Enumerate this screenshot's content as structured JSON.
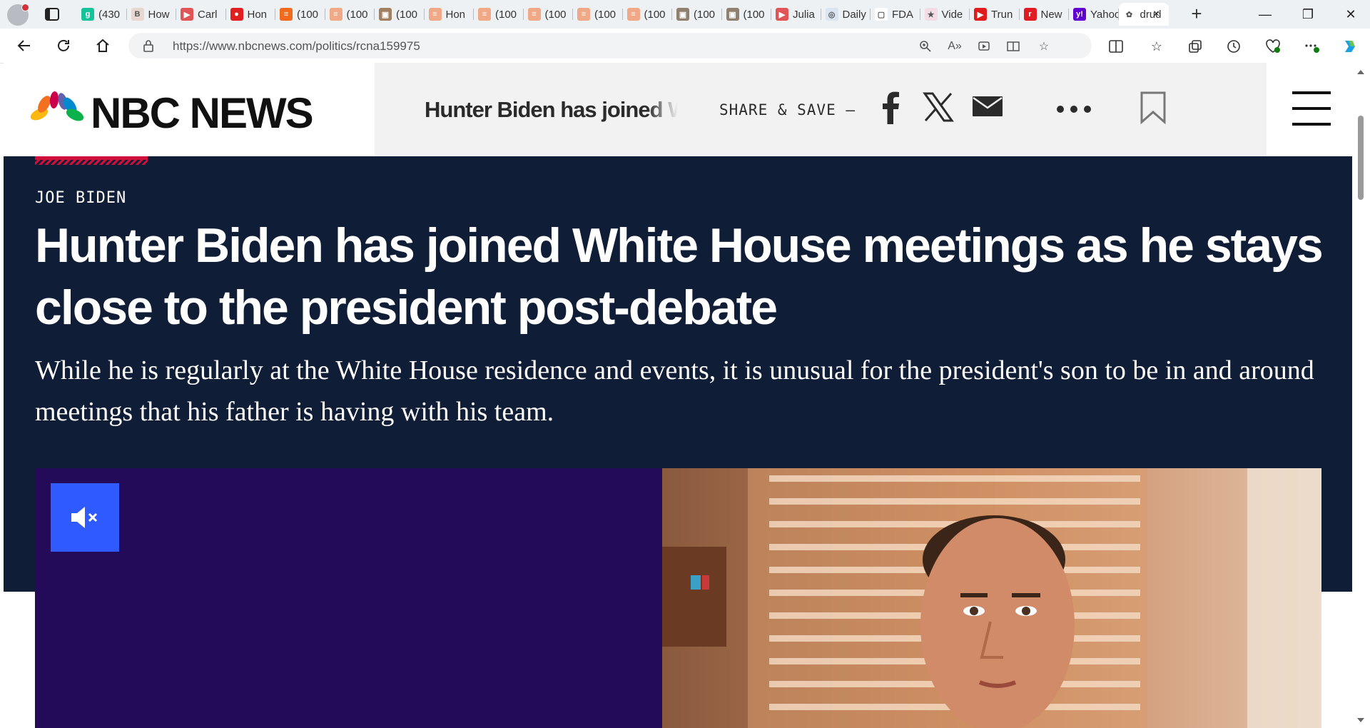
{
  "browser": {
    "tabs": [
      {
        "label": "(430",
        "icon": "grammarly-icon",
        "color": "#15c39a",
        "glyph": "g"
      },
      {
        "label": "How",
        "icon": "bi-icon",
        "color": "#e8d6d0",
        "glyph": "B"
      },
      {
        "label": "Carl",
        "icon": "youtube-icon",
        "color": "#e05555",
        "glyph": "▶"
      },
      {
        "label": "Hon",
        "icon": "pin-icon",
        "color": "#e02020",
        "glyph": "●"
      },
      {
        "label": "(100",
        "icon": "reader-icon",
        "color": "#f26b1d",
        "glyph": "≡"
      },
      {
        "label": "(100",
        "icon": "reader-icon",
        "color": "#f0a887",
        "glyph": "≡"
      },
      {
        "label": "(100",
        "icon": "photo-icon",
        "color": "#a08060",
        "glyph": "▣"
      },
      {
        "label": "Hon",
        "icon": "reader-icon",
        "color": "#f0a887",
        "glyph": "≡"
      },
      {
        "label": "(100",
        "icon": "reader-icon",
        "color": "#f0a887",
        "glyph": "≡"
      },
      {
        "label": "(100",
        "icon": "reader-icon",
        "color": "#f0a887",
        "glyph": "≡"
      },
      {
        "label": "(100",
        "icon": "reader-icon",
        "color": "#f0a887",
        "glyph": "≡"
      },
      {
        "label": "(100",
        "icon": "reader-icon",
        "color": "#f0a887",
        "glyph": "≡"
      },
      {
        "label": "(100",
        "icon": "photo-icon",
        "color": "#908070",
        "glyph": "▣"
      },
      {
        "label": "(100",
        "icon": "photo-icon",
        "color": "#908070",
        "glyph": "▣"
      },
      {
        "label": "Julia",
        "icon": "youtube-icon",
        "color": "#e05555",
        "glyph": "▶"
      },
      {
        "label": "Daily",
        "icon": "globe-icon",
        "color": "#d9e6f2",
        "glyph": "◎"
      },
      {
        "label": "FDA",
        "icon": "page-icon",
        "color": "#ffffff",
        "glyph": "▢"
      },
      {
        "label": "Vide",
        "icon": "star-icon",
        "color": "#f4dbe6",
        "glyph": "★"
      },
      {
        "label": "Trun",
        "icon": "youtube-icon",
        "color": "#e01b1b",
        "glyph": "▶"
      },
      {
        "label": "New",
        "icon": "r-icon",
        "color": "#e01b24",
        "glyph": "r"
      },
      {
        "label": "Yahoo",
        "icon": "yahoo-icon",
        "color": "#6001d2",
        "glyph": "y!"
      },
      {
        "label": "drud",
        "icon": "nbc-icon",
        "color": "#ffffff",
        "glyph": "✿",
        "active": true
      }
    ],
    "new_tab_glyph": "+",
    "close_tab_glyph": "×",
    "window": {
      "minimize": "—",
      "maximize": "❐",
      "close": "✕"
    },
    "url": "https://www.nbcnews.com/politics/rcna159975"
  },
  "site": {
    "brand": "NBC NEWS",
    "sticky_title": "Hunter Biden has joined White House meetings as he stays close to the president post-debate",
    "share_label": "SHARE & SAVE —",
    "share_icons": [
      "facebook-icon",
      "x-icon",
      "email-icon",
      "more-icon",
      "bookmark-icon"
    ]
  },
  "article": {
    "eyebrow": "JOE BIDEN",
    "headline": "Hunter Biden has joined White House meetings as he stays close to the president post-debate",
    "dek": "While he is regularly at the White House residence and events, it is unusual for the president's son to be in and around meetings that his father is having with his team."
  },
  "colors": {
    "hero_bg": "#101d36",
    "accent_red": "#d0103a",
    "video_bg": "#240b5a",
    "mute_button": "#2f5aff"
  }
}
